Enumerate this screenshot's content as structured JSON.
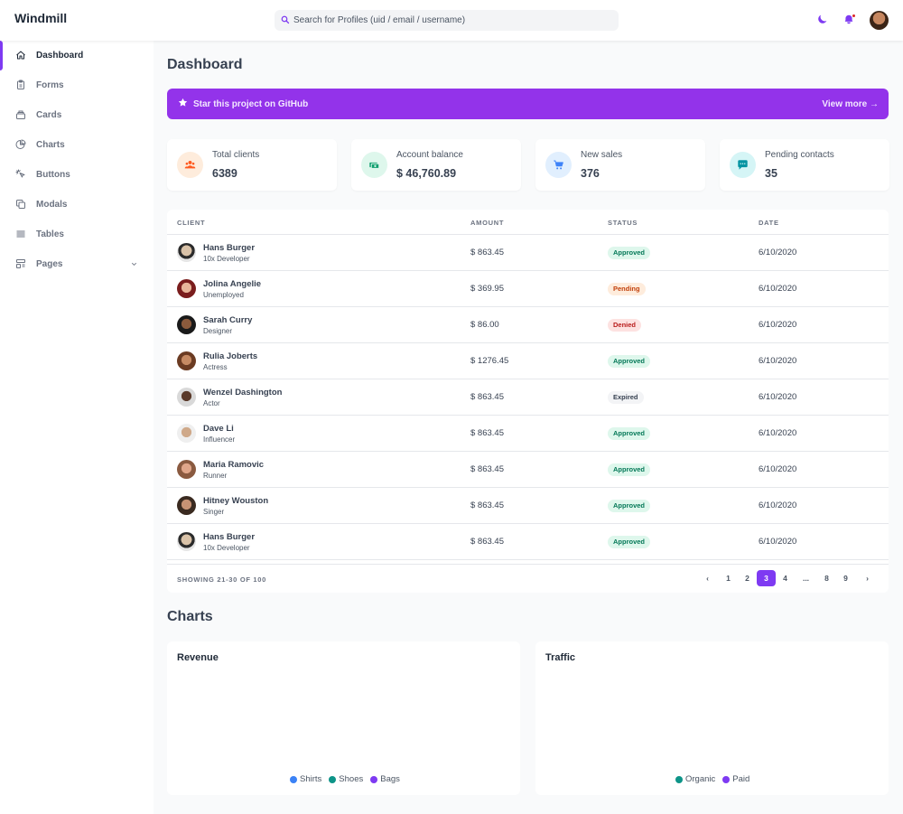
{
  "app": {
    "title": "Windmill",
    "search_placeholder": "Search for Profiles (uid / email / username)"
  },
  "sidebar": {
    "items": [
      {
        "label": "Dashboard",
        "icon": "home-icon"
      },
      {
        "label": "Forms",
        "icon": "clipboard-icon"
      },
      {
        "label": "Cards",
        "icon": "cards-icon"
      },
      {
        "label": "Charts",
        "icon": "pie-chart-icon"
      },
      {
        "label": "Buttons",
        "icon": "cursor-click-icon"
      },
      {
        "label": "Modals",
        "icon": "modals-icon"
      },
      {
        "label": "Tables",
        "icon": "table-icon"
      },
      {
        "label": "Pages",
        "icon": "pages-icon"
      }
    ],
    "active": "Dashboard"
  },
  "page": {
    "title": "Dashboard",
    "banner_text": "Star this project on GitHub",
    "banner_link": "View more →"
  },
  "stats": [
    {
      "label": "Total clients",
      "value": "6389",
      "icon": "users-icon",
      "color": "#ff5a1f",
      "bg": "#feecdc"
    },
    {
      "label": "Account balance",
      "value": "$ 46,760.89",
      "icon": "money-icon",
      "color": "#0e9f6e",
      "bg": "#def7ec"
    },
    {
      "label": "New sales",
      "value": "376",
      "icon": "cart-icon",
      "color": "#3f83f8",
      "bg": "#e1effe"
    },
    {
      "label": "Pending contacts",
      "value": "35",
      "icon": "chat-icon",
      "color": "#0694a2",
      "bg": "#d5f5f6"
    }
  ],
  "table": {
    "headers": [
      "CLIENT",
      "AMOUNT",
      "STATUS",
      "DATE"
    ],
    "rows": [
      {
        "name": "Hans Burger",
        "role": "10x Developer",
        "amount": "$ 863.45",
        "status": "Approved",
        "date": "6/10/2020"
      },
      {
        "name": "Jolina Angelie",
        "role": "Unemployed",
        "amount": "$ 369.95",
        "status": "Pending",
        "date": "6/10/2020"
      },
      {
        "name": "Sarah Curry",
        "role": "Designer",
        "amount": "$ 86.00",
        "status": "Denied",
        "date": "6/10/2020"
      },
      {
        "name": "Rulia Joberts",
        "role": "Actress",
        "amount": "$ 1276.45",
        "status": "Approved",
        "date": "6/10/2020"
      },
      {
        "name": "Wenzel Dashington",
        "role": "Actor",
        "amount": "$ 863.45",
        "status": "Expired",
        "date": "6/10/2020"
      },
      {
        "name": "Dave Li",
        "role": "Influencer",
        "amount": "$ 863.45",
        "status": "Approved",
        "date": "6/10/2020"
      },
      {
        "name": "Maria Ramovic",
        "role": "Runner",
        "amount": "$ 863.45",
        "status": "Approved",
        "date": "6/10/2020"
      },
      {
        "name": "Hitney Wouston",
        "role": "Singer",
        "amount": "$ 863.45",
        "status": "Approved",
        "date": "6/10/2020"
      },
      {
        "name": "Hans Burger",
        "role": "10x Developer",
        "amount": "$ 863.45",
        "status": "Approved",
        "date": "6/10/2020"
      }
    ],
    "showing": "SHOWING 21-30 OF 100",
    "pagination": [
      "‹",
      "1",
      "2",
      "3",
      "4",
      "...",
      "8",
      "9",
      "›"
    ],
    "current_page": "3"
  },
  "charts": {
    "section_title": "Charts",
    "revenue": {
      "title": "Revenue",
      "legend": [
        {
          "label": "Shirts",
          "color": "#3b82f6"
        },
        {
          "label": "Shoes",
          "color": "#0d9488"
        },
        {
          "label": "Bags",
          "color": "#7e3af2"
        }
      ]
    },
    "traffic": {
      "title": "Traffic",
      "legend": [
        {
          "label": "Organic",
          "color": "#0d9488"
        },
        {
          "label": "Paid",
          "color": "#7e3af2"
        }
      ]
    }
  }
}
